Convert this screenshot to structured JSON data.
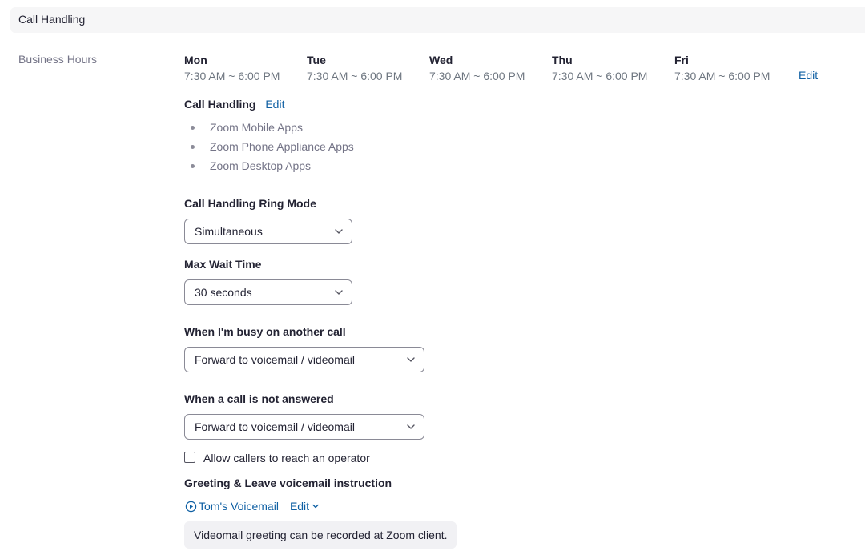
{
  "section": {
    "title": "Call Handling"
  },
  "business_hours": {
    "label": "Business Hours",
    "days": [
      {
        "name": "Mon",
        "time": "7:30 AM ~ 6:00 PM"
      },
      {
        "name": "Tue",
        "time": "7:30 AM ~ 6:00 PM"
      },
      {
        "name": "Wed",
        "time": "7:30 AM ~ 6:00 PM"
      },
      {
        "name": "Thu",
        "time": "7:30 AM ~ 6:00 PM"
      },
      {
        "name": "Fri",
        "time": "7:30 AM ~ 6:00 PM"
      }
    ],
    "edit_label": "Edit"
  },
  "call_handling": {
    "title": "Call Handling",
    "edit_label": "Edit",
    "apps": [
      "Zoom Mobile Apps",
      "Zoom Phone Appliance Apps",
      "Zoom Desktop Apps"
    ]
  },
  "ring_mode": {
    "label": "Call Handling Ring Mode",
    "value": "Simultaneous"
  },
  "max_wait": {
    "label": "Max Wait Time",
    "value": "30 seconds"
  },
  "busy": {
    "label": "When I'm busy on another call",
    "value": "Forward to voicemail / videomail"
  },
  "not_answered": {
    "label": "When a call is not answered",
    "value": "Forward to voicemail / videomail"
  },
  "operator": {
    "label": "Allow callers to reach an operator",
    "checked": false
  },
  "greeting": {
    "title": "Greeting & Leave voicemail instruction",
    "voicemail_name": "Tom's Voicemail",
    "edit_label": "Edit",
    "note": "Videomail greeting can be recorded at Zoom client."
  },
  "colors": {
    "link": "#0e5fa3",
    "muted_text": "#747487",
    "header_bg": "#f6f6f7",
    "note_bg": "#f1f1f4"
  },
  "icons": {
    "select_arrow": "chevron-down-icon",
    "play": "play-circle-icon",
    "edit_dropdown": "chevron-down-icon"
  }
}
